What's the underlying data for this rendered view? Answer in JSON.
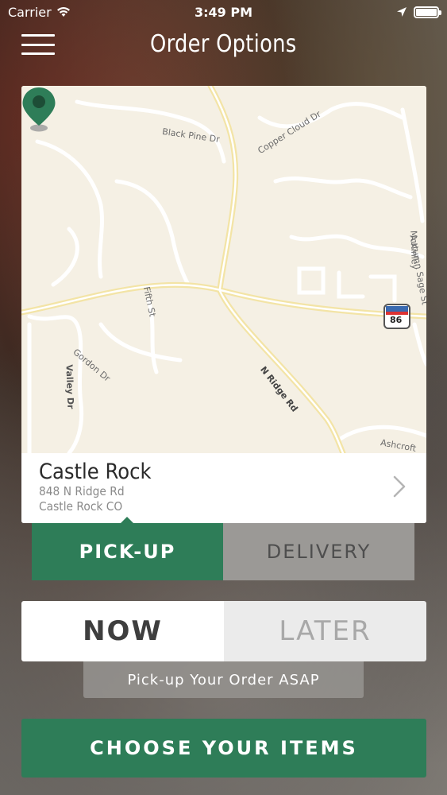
{
  "status_bar": {
    "carrier": "Carrier",
    "time": "3:49 PM"
  },
  "header": {
    "title": "Order Options",
    "menu_icon": "hamburger-menu-icon"
  },
  "map": {
    "labels": {
      "black_pine": "Black Pine Dr",
      "copper_cloud": "Copper Cloud Dr",
      "fifth": "Fifth St",
      "gordon": "Gordon Dr",
      "valley": "Valley Dr",
      "n_ridge": "N Ridge Rd",
      "mckinley": "McKinley",
      "autumn_sage": "Autumn Sage St",
      "ashcroft": "Ashcroft",
      "route_shield": "86"
    },
    "pin_color": "#2e7d58"
  },
  "location": {
    "name": "Castle Rock",
    "address_line1": "848 N Ridge Rd",
    "address_line2": "Castle Rock CO"
  },
  "fulfillment": {
    "pickup_label": "PICK-UP",
    "delivery_label": "DELIVERY",
    "selected": "PICK-UP"
  },
  "timing": {
    "now_label": "NOW",
    "later_label": "LATER",
    "selected": "NOW",
    "note": "Pick-up Your Order ASAP"
  },
  "cta": {
    "label": "CHOOSE YOUR ITEMS"
  },
  "colors": {
    "accent_green": "#2e7d58",
    "inactive_grey": "#9b9996"
  }
}
